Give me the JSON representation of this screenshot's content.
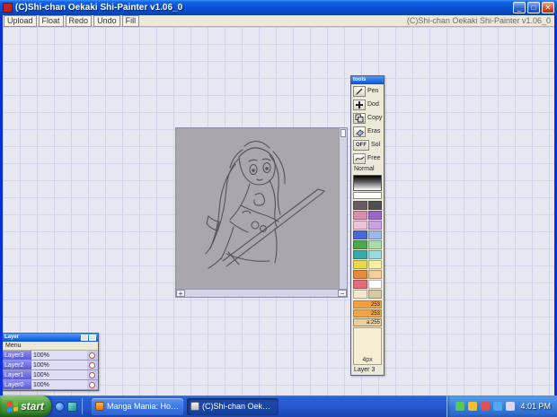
{
  "window": {
    "title": "(C)Shi-chan Oekaki Shi-Painter v1.06_0",
    "minimize_glyph": "_",
    "maximize_glyph": "□",
    "close_glyph": "✕"
  },
  "menubar": {
    "buttons": [
      "Upload",
      "Float",
      "Redo",
      "Undo",
      "Fill"
    ],
    "right_text": "(C)Shi-chan Oekaki Shi-Painter v1.06_0"
  },
  "canvas": {
    "zoom_in": "+",
    "zoom_out": "−"
  },
  "tools_palette": {
    "title": "tools",
    "tools": [
      {
        "label": "Pen"
      },
      {
        "label": "Dod"
      },
      {
        "label": "Copy"
      },
      {
        "label": "Eras"
      },
      {
        "label": "Sol",
        "toggle": "OFF"
      },
      {
        "label": "Free"
      }
    ],
    "blend_mode": "Normal",
    "palette": [
      "#6b5d5d",
      "#4f4f4f",
      "#d88cb0",
      "#9a66c8",
      "#f0c2d6",
      "#c9a0e8",
      "#4a66d8",
      "#9db8ea",
      "#4aa84a",
      "#a8dca8",
      "#38a8a8",
      "#9adada",
      "#e8d84a",
      "#f8f0a0",
      "#e8883a",
      "#f8cc9a",
      "#e86a7a",
      "#ffffff",
      "#f5e8cc",
      "#d8c8a4"
    ],
    "sliders": [
      {
        "value": "253",
        "color": "#f0a040"
      },
      {
        "value": "253",
        "color": "#f0a448"
      },
      {
        "value": "a:255",
        "color": "#e8d0a0"
      }
    ],
    "brush_size": "4px",
    "active_layer": "Layer 3"
  },
  "layers_panel": {
    "title": "Layer",
    "menu_label": "Menu",
    "layers": [
      {
        "name": "Layer3",
        "opacity": "100%"
      },
      {
        "name": "Layer2",
        "opacity": "100%"
      },
      {
        "name": "Layer1",
        "opacity": "100%"
      },
      {
        "name": "Layer0",
        "opacity": "100%"
      }
    ]
  },
  "taskbar": {
    "start_label": "start",
    "tasks": [
      {
        "label": "Manga Mania: How to..."
      },
      {
        "label": "(C)Shi-chan Oekaki S..."
      }
    ],
    "clock": "4:01 PM"
  },
  "colors": {
    "titlebar_blue": "#0b54d8",
    "taskbar_blue": "#2557cc",
    "start_green": "#47a038",
    "flag_red": "#e8502f",
    "flag_green": "#7db72f",
    "flag_blue": "#2e8fe8",
    "flag_yellow": "#f8b12c",
    "tray_icon_1": "#58c858",
    "tray_icon_2": "#f0c030",
    "tray_icon_3": "#e05050",
    "tray_icon_4": "#50a8f0",
    "tray_icon_5": "#d8d8f4"
  }
}
